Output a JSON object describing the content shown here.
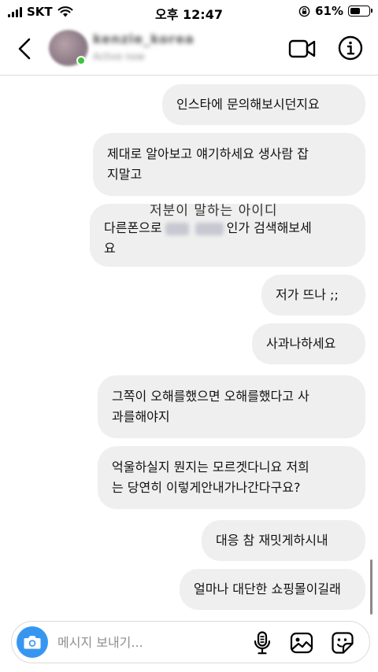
{
  "status_bar": {
    "carrier": "SKT",
    "time": "오후 12:47",
    "battery_percent": "61%",
    "battery_level": 0.61
  },
  "header": {
    "username": "kenzie_korea",
    "subtitle": "Active now",
    "icons": [
      "chevron-left-icon",
      "video-icon",
      "info-icon"
    ]
  },
  "overlay_text": "저분이 말하는 아이디",
  "messages": [
    {
      "id": "m1",
      "text": "인스타에 문의해보시던지요"
    },
    {
      "id": "m2",
      "line1": "제대로 알아보고 얘기하세요 생사람 잡",
      "line2": "지말고"
    },
    {
      "id": "m3",
      "line1_a": "다른폰으로",
      "line1_b": "인가 검색해보세",
      "line2": "요"
    },
    {
      "id": "m4",
      "text": "저가 뜨나 ;;"
    },
    {
      "id": "m5",
      "text": "사과나하세요"
    },
    {
      "id": "m6",
      "line1": "그쪽이 오해를했으면 오해를했다고 사",
      "line2": "과를해야지"
    },
    {
      "id": "m7",
      "line1": "억울하실지 뭔지는 모르겟다니요 저희",
      "line2": "는 당연히 이렇게안내가나간다구요?"
    },
    {
      "id": "m8",
      "text": "대응 참 재밋게하시내"
    },
    {
      "id": "m9",
      "text": "얼마나 대단한 쇼핑몰이길래"
    }
  ],
  "composer": {
    "placeholder": "메시지 보내기...",
    "value": ""
  },
  "colors": {
    "bubble": "#efefef",
    "camera_button": "#3797f0",
    "online": "#3ec33e"
  }
}
